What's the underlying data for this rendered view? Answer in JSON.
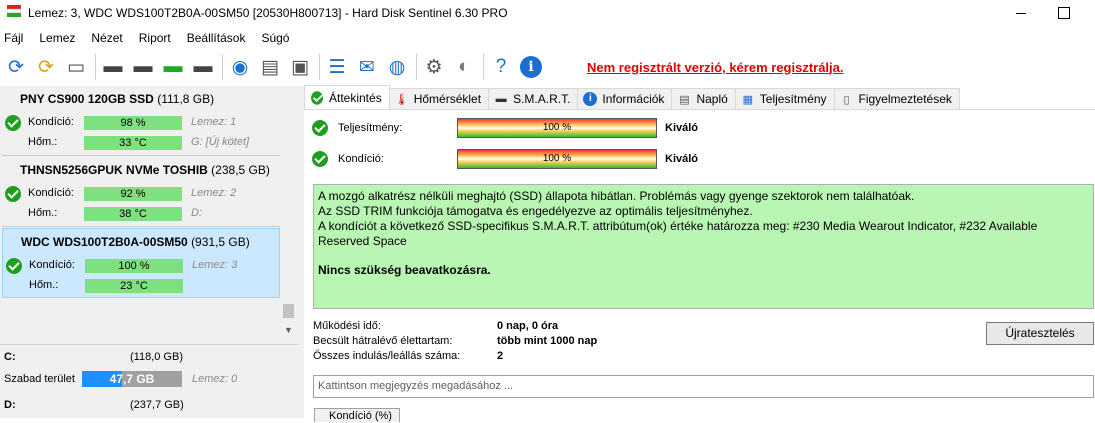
{
  "window": {
    "title": "Lemez: 3, WDC  WDS100T2B0A-00SM50 [20530H800713]  -  Hard Disk Sentinel 6.30 PRO"
  },
  "menu": [
    "Fájl",
    "Lemez",
    "Nézet",
    "Riport",
    "Beállítások",
    "Súgó"
  ],
  "toolbar": {
    "unregistered": "Nem regisztrált verzió, kérem regisztrálja."
  },
  "disks": [
    {
      "name": "PNY CS900 120GB SSD",
      "size": "(111,8 GB)",
      "condition_label": "Kondíció:",
      "condition": "98 %",
      "temp_label": "Hőm.:",
      "temp": "33 °C",
      "disk_index": "Lemez: 1",
      "drive_info": "G: [Új kötet]"
    },
    {
      "name": "THNSN5256GPUK NVMe TOSHIB",
      "size": "(238,5 GB)",
      "condition_label": "Kondíció:",
      "condition": "92 %",
      "temp_label": "Hőm.:",
      "temp": "38 °C",
      "disk_index": "Lemez: 2",
      "drive_info": "D:"
    },
    {
      "name": "WDC  WDS100T2B0A-00SM50",
      "size": "(931,5 GB)",
      "condition_label": "Kondíció:",
      "condition": "100 %",
      "temp_label": "Hőm.:",
      "temp": "23 °C",
      "disk_index": "Lemez: 3",
      "drive_info": ""
    }
  ],
  "partitions": [
    {
      "name": "C:",
      "size": "(118,0 GB)",
      "free_label": "Szabad terület",
      "free": "47,7 GB",
      "free_fraction": 0.4,
      "disk_index": "Lemez: 0"
    },
    {
      "name": "D:",
      "size": "(237,7 GB)"
    }
  ],
  "tabs": [
    {
      "label": "Áttekintés",
      "icon": "check-icon"
    },
    {
      "label": "Hőmérséklet",
      "icon": "thermometer-icon"
    },
    {
      "label": "S.M.A.R.T.",
      "icon": "smart-icon"
    },
    {
      "label": "Információk",
      "icon": "info-icon"
    },
    {
      "label": "Napló",
      "icon": "log-icon"
    },
    {
      "label": "Teljesítmény",
      "icon": "performance-icon"
    },
    {
      "label": "Figyelmeztetések",
      "icon": "alerts-icon"
    }
  ],
  "overview": {
    "performance_label": "Teljesítmény:",
    "performance_value": "100 %",
    "performance_rating": "Kiváló",
    "condition_label": "Kondíció:",
    "condition_value": "100 %",
    "condition_rating": "Kiváló",
    "info_lines": [
      "A mozgó alkatrész nélküli meghajtó (SSD) állapota hibátlan. Problémás vagy gyenge szektorok nem találhatóak.",
      "Az SSD TRIM funkciója támogatva és engedélyezve az optimális teljesítményhez.",
      "A kondíciót a következő SSD-specifikus S.M.A.R.T. attribútum(ok) értéke határozza meg:  #230 Media Wearout Indicator, #232 Available Reserved Space"
    ],
    "recommendation": "Nincs szükség beavatkozásra.",
    "uptime_label": "Működési idő:",
    "uptime_value": "0 nap, 0 óra",
    "lifetime_label": "Becsült hátralévő élettartam:",
    "lifetime_value": "több mint 1000 nap",
    "starts_label": "Összes indulás/leállás száma:",
    "starts_value": "2",
    "retest_button": "Újratesztelés",
    "comment_placeholder": "Kattintson megjegyzés megadásához ...",
    "bottom_tab": "Kondíció (%)"
  },
  "colors": {
    "ok_green": "#1f9f1f",
    "info_bg": "#b9f5b3",
    "unregistered_red": "#e00000",
    "selected_bg": "#cce8ff",
    "free_bar": "#1e90ff"
  }
}
